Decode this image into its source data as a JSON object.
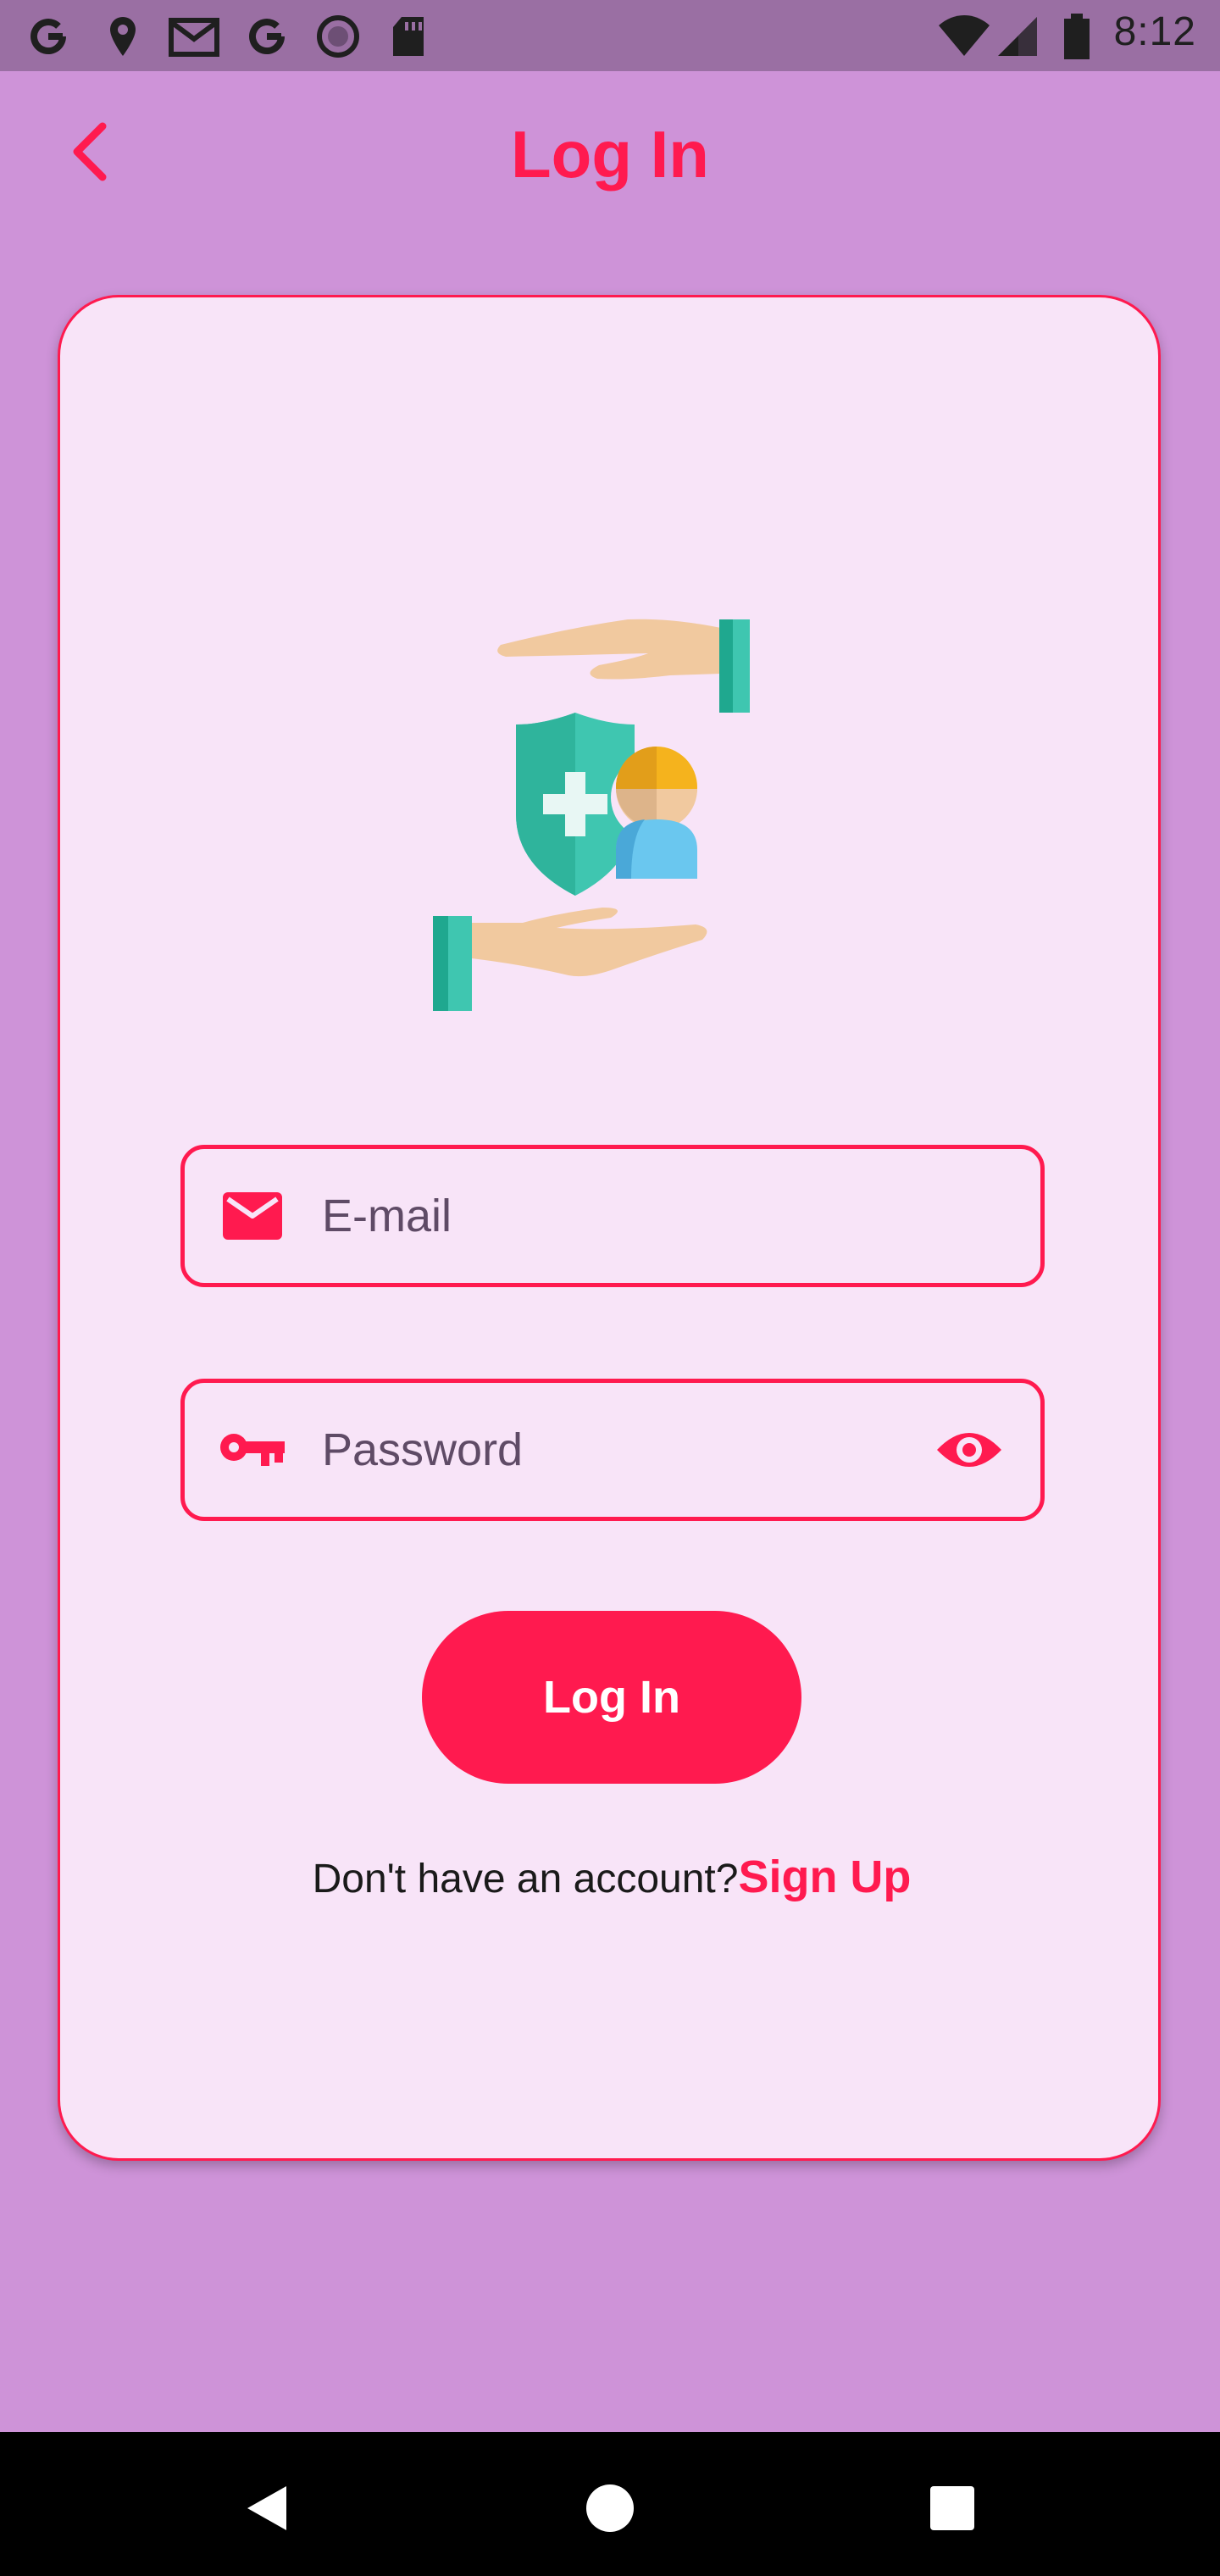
{
  "status_bar": {
    "time": "8:12",
    "notification_icons": [
      "google-icon",
      "location-pin-icon",
      "gmail-icon",
      "google-icon",
      "circle-app-icon",
      "sd-card-icon"
    ],
    "system_icons": [
      "wifi-icon",
      "cell-signal-icon",
      "battery-icon"
    ]
  },
  "header": {
    "title": "Log In",
    "back_icon": "chevron-left-icon"
  },
  "colors": {
    "accent": "#ff1a4f",
    "background": "#ce93d8",
    "card": "#f8e4f8",
    "status_bar": "#9a6fa3",
    "nav_bar": "#000000"
  },
  "illustration": {
    "icon": "insurance-hands-shield-person-icon"
  },
  "form": {
    "email": {
      "placeholder": "E-mail",
      "value": "",
      "icon": "envelope-icon"
    },
    "password": {
      "placeholder": "Password",
      "value": "",
      "icon": "key-icon",
      "toggle_icon": "eye-icon"
    },
    "submit_label": "Log In",
    "signup_prompt": "Don't have an account?",
    "signup_link": "Sign Up"
  },
  "nav_bar": {
    "buttons": [
      "back-triangle-icon",
      "home-circle-icon",
      "recents-square-icon"
    ]
  }
}
